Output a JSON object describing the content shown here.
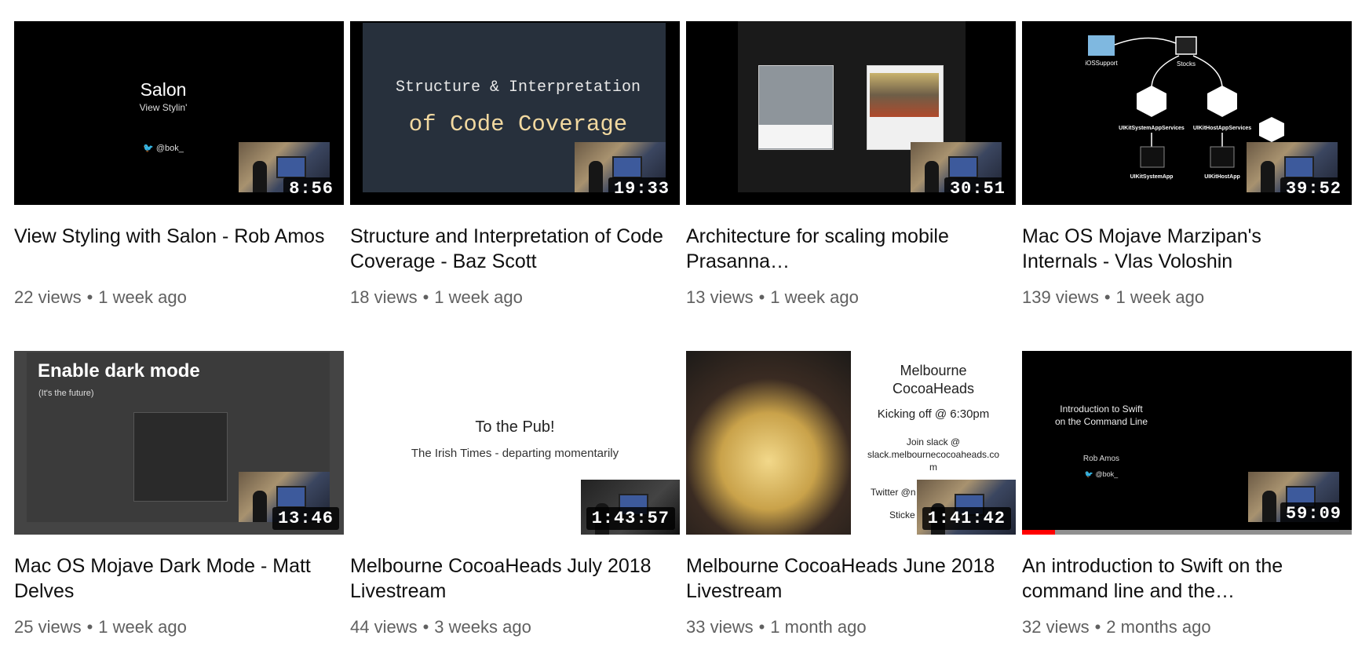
{
  "videos": [
    {
      "title": "View Styling with Salon - Rob Amos",
      "views": "22 views",
      "age": "1 week ago",
      "duration": "8:56",
      "thumb": {
        "heading": "Salon",
        "sub": "View Stylin'",
        "handle": "@bok_"
      }
    },
    {
      "title": "Structure and Interpretation of Code Coverage - Baz Scott",
      "views": "18 views",
      "age": "1 week ago",
      "duration": "19:33",
      "thumb": {
        "line1": "Structure & Interpretation",
        "line2": "of Code Coverage"
      }
    },
    {
      "title": "Architecture for scaling mobile Prasanna…",
      "views": "13 views",
      "age": "1 week ago",
      "duration": "30:51"
    },
    {
      "title": "Mac OS Mojave Marzipan's Internals - Vlas Voloshin",
      "views": "139 views",
      "age": "1 week ago",
      "duration": "39:52",
      "thumb": {
        "n1": "iOSSupport",
        "n2": "Stocks",
        "n3": "UIKitSystemAppServices",
        "n4": "UIKitHostAppServices",
        "n5": "UIKitSystemApp",
        "n6": "UIKitHostApp"
      }
    },
    {
      "title": "Mac OS Mojave Dark Mode - Matt Delves",
      "views": "25 views",
      "age": "1 week ago",
      "duration": "13:46",
      "thumb": {
        "heading": "Enable dark mode",
        "sub": "(It's the future)"
      }
    },
    {
      "title": "Melbourne CocoaHeads July 2018 Livestream",
      "views": "44 views",
      "age": "3 weeks ago",
      "duration": "1:43:57",
      "thumb": {
        "heading": "To the Pub!",
        "sub": "The Irish Times - departing momentarily"
      }
    },
    {
      "title": "Melbourne CocoaHeads June 2018 Livestream",
      "views": "33 views",
      "age": "1 month ago",
      "duration": "1:41:42",
      "thumb": {
        "l1": "Melbourne",
        "l2": "CocoaHeads",
        "l3": "Kicking off @ 6:30pm",
        "l4": "Join slack @",
        "l5": "slack.melbournecocoaheads.co",
        "l6": "m",
        "l7": "Twitter @n",
        "l8": "Sticke"
      }
    },
    {
      "title": "An introduction to Swift on the command line and the…",
      "views": "32 views",
      "age": "2 months ago",
      "duration": "59:09",
      "progress": 0.1,
      "thumb": {
        "heading": "Introduction to Swift",
        "heading2": "on the Command Line",
        "author": "Rob Amos",
        "handle": "@bok_"
      }
    }
  ],
  "separator": "•"
}
